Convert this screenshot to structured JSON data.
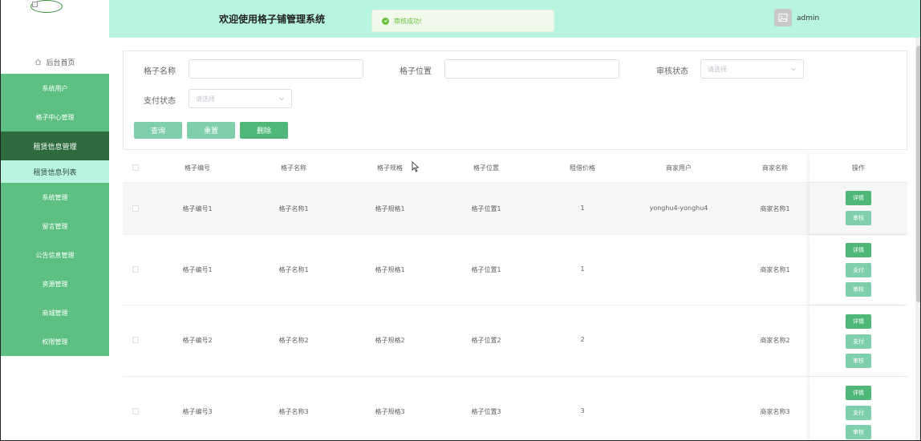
{
  "header": {
    "title": "欢迎使用格子铺管理系统",
    "toast": "审核成功!",
    "username": "admin"
  },
  "sidebar": {
    "home": "后台首页",
    "items": [
      {
        "label": "系统用户",
        "state": "normal"
      },
      {
        "label": "格子中心管理",
        "state": "normal"
      },
      {
        "label": "租赁信息管理",
        "state": "active"
      },
      {
        "label": "租赁信息列表",
        "state": "sub"
      },
      {
        "label": "系统管理",
        "state": "normal"
      },
      {
        "label": "留言管理",
        "state": "normal"
      },
      {
        "label": "公告信息管理",
        "state": "normal"
      },
      {
        "label": "资源管理",
        "state": "normal"
      },
      {
        "label": "商城管理",
        "state": "normal"
      },
      {
        "label": "权限管理",
        "state": "normal"
      }
    ]
  },
  "search": {
    "name_label": "格子名称",
    "name_value": "",
    "location_label": "格子位置",
    "location_value": "",
    "audit_label": "审核状态",
    "audit_placeholder": "请选择",
    "pay_label": "支付状态",
    "pay_placeholder": "请选择",
    "query_button": "查询",
    "reset_button": "重置",
    "delete_button": "删除"
  },
  "table": {
    "columns": [
      "格子编号",
      "格子名称",
      "格子规格",
      "格子位置",
      "租借价格",
      "商家用户",
      "商家名称",
      "操作"
    ],
    "rows": [
      {
        "code": "格子编号1",
        "name": "格子名称1",
        "spec": "格子规格1",
        "location": "格子位置1",
        "price": "1",
        "merchant_user": "yonghu4-yonghu4",
        "merchant_name": "商家名称1",
        "actions": [
          "详情",
          "审核"
        ]
      },
      {
        "code": "格子编号1",
        "name": "格子名称1",
        "spec": "格子规格1",
        "location": "格子位置1",
        "price": "1",
        "merchant_user": "",
        "merchant_name": "商家名称1",
        "actions": [
          "详情",
          "支付",
          "审核"
        ]
      },
      {
        "code": "格子编号2",
        "name": "格子名称2",
        "spec": "格子规格2",
        "location": "格子位置2",
        "price": "2",
        "merchant_user": "",
        "merchant_name": "商家名称2",
        "actions": [
          "详情",
          "支付",
          "审核"
        ]
      },
      {
        "code": "格子编号3",
        "name": "格子名称3",
        "spec": "格子规格3",
        "location": "格子位置3",
        "price": "3",
        "merchant_user": "",
        "merchant_name": "商家名称3",
        "actions": [
          "详情",
          "支付",
          "审核"
        ]
      }
    ]
  },
  "colors": {
    "sidebar_green": "#5dbf82",
    "sidebar_active": "#2e6b3f",
    "header_mint": "#b8f5e0",
    "button_primary": "#4fb878",
    "button_light": "#7fceac",
    "toast_green": "#67c23a"
  }
}
